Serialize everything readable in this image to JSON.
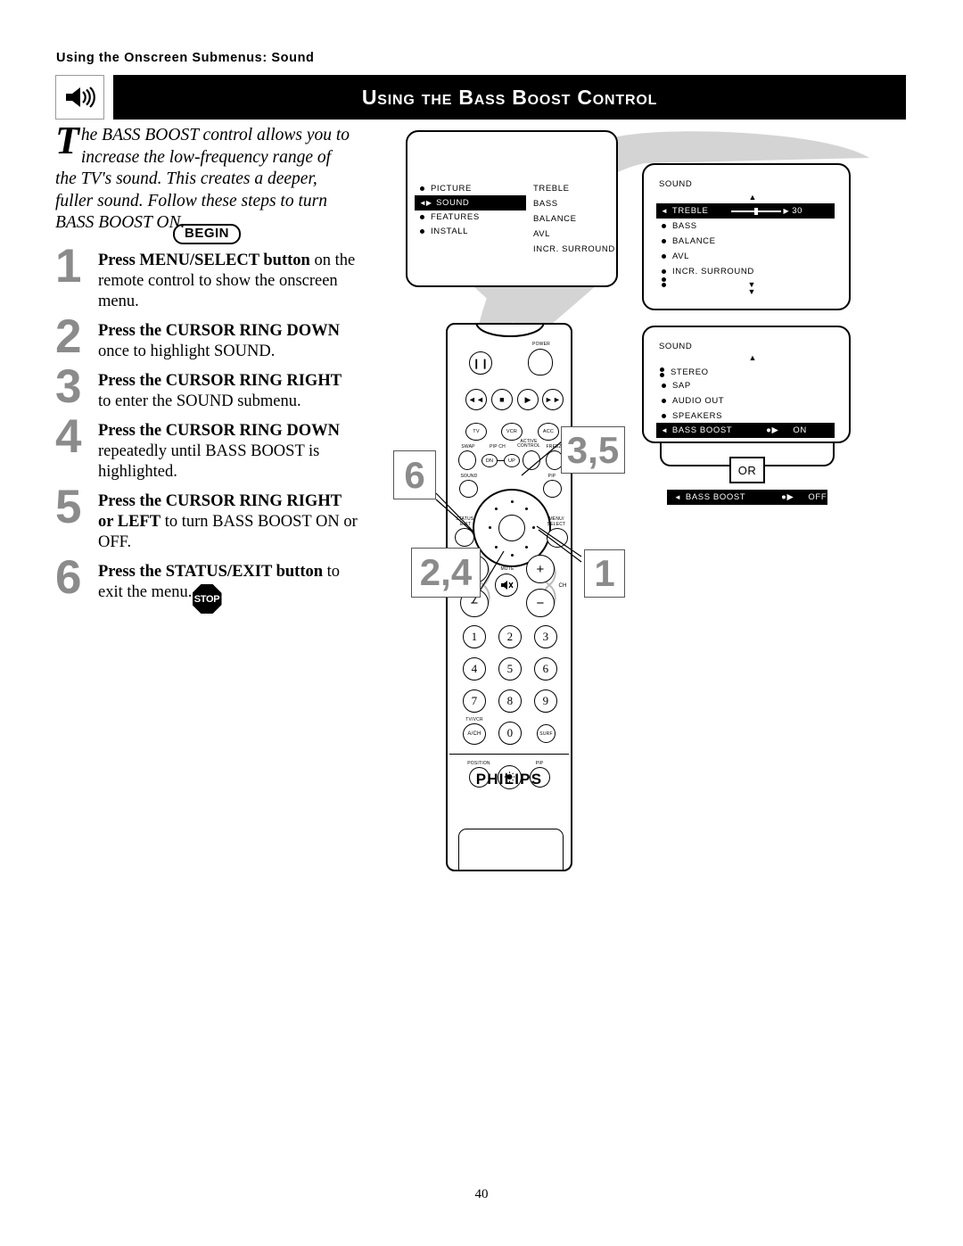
{
  "running_head": "Using the Onscreen Submenus: Sound",
  "header": {
    "icon": "speaker-sound-icon",
    "title": "Using the Bass Boost Control"
  },
  "intro": {
    "dropcap": "T",
    "text": "he BASS BOOST control allows you to increase the low-frequency range of the TV's sound. This creates a deeper, fuller sound. Follow these steps to turn BASS BOOST ON."
  },
  "begin_label": "BEGIN",
  "stop_label": "STOP",
  "steps": [
    {
      "num": "1",
      "bold": "Press MENU/SELECT button",
      "rest": " on the remote control to show the onscreen menu."
    },
    {
      "num": "2",
      "bold": "Press the CURSOR RING DOWN",
      "rest": " once to highlight SOUND."
    },
    {
      "num": "3",
      "bold": "Press the CURSOR RING RIGHT",
      "rest": " to enter the SOUND submenu."
    },
    {
      "num": "4",
      "bold": "Press the CURSOR RING DOWN",
      "rest": " repeatedly until BASS BOOST is highlighted."
    },
    {
      "num": "5",
      "bold": "Press the CURSOR RING RIGHT or LEFT",
      "rest": " to turn BASS BOOST ON or OFF."
    },
    {
      "num": "6",
      "bold": "Press the STATUS/EXIT button",
      "rest": " to exit the menu."
    }
  ],
  "screens": {
    "screen1": {
      "left_items": [
        "PICTURE",
        "SOUND",
        "FEATURES",
        "INSTALL"
      ],
      "highlighted": "SOUND",
      "right_items": [
        "TREBLE",
        "BASS",
        "BALANCE",
        "AVL",
        "INCR. SURROUND"
      ]
    },
    "screen2": {
      "title": "SOUND",
      "items": [
        "TREBLE",
        "BASS",
        "BALANCE",
        "AVL",
        "INCR. SURROUND"
      ],
      "highlighted": "TREBLE",
      "value": "30",
      "scroll_up": "▲",
      "scroll_down": "▼"
    },
    "screen3": {
      "title": "SOUND",
      "items": [
        "STEREO",
        "SAP",
        "AUDIO OUT",
        "SPEAKERS",
        "BASS BOOST"
      ],
      "highlighted": "BASS BOOST",
      "value": "ON",
      "scroll_up": "▲"
    },
    "or_label": "OR",
    "alt_bar": {
      "label": "BASS BOOST",
      "value": "OFF"
    }
  },
  "remote": {
    "brand": "PHILIPS",
    "power_label": "POWER",
    "transport": [
      "rewind-icon",
      "stop-icon",
      "play-icon",
      "fast-forward-icon"
    ],
    "pause_label": "pause-icon",
    "source_buttons": [
      "TV",
      "VCR",
      "ACC"
    ],
    "feature_labels": [
      "SWAP",
      "PIP CH",
      "ACTIVE CONTROL",
      "FREEZE"
    ],
    "pip_ch_buttons": [
      "DN",
      "UP"
    ],
    "sound_label": "SOUND",
    "pip_label": "PIP",
    "status_exit_label": "STATUS/ EXIT",
    "menu_select_label": "MENU/ SELECT",
    "mute_label": "MUTE",
    "ch_label": "CH",
    "vol_plus": "+",
    "vol_minus": "−",
    "ch_plus": "+",
    "ch_minus": "−",
    "keypad": [
      "1",
      "2",
      "3",
      "4",
      "5",
      "6",
      "7",
      "8",
      "9",
      "A/CH",
      "0",
      "SURF"
    ],
    "tvvcr_label": "TV/VCR",
    "bottom_buttons": [
      "POSITION",
      "PIP"
    ],
    "light_icon": "lightbulb-icon"
  },
  "callouts": [
    {
      "id": "6",
      "text": "6"
    },
    {
      "id": "24",
      "text": "2,4"
    },
    {
      "id": "35",
      "text": "3,5"
    },
    {
      "id": "1",
      "text": "1"
    }
  ],
  "page_number": "40"
}
